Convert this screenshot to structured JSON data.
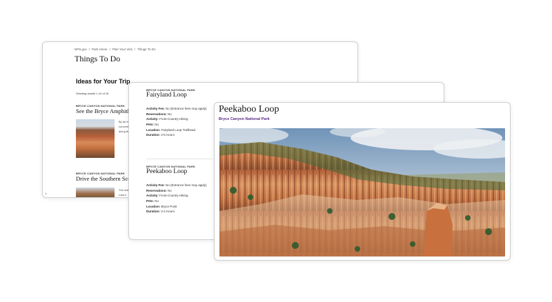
{
  "list_page": {
    "breadcrumb": [
      "NPS.gov",
      "Park Home",
      "Plan Your Visit",
      "Things To Do"
    ],
    "page_title": "Things To Do",
    "section_title": "Ideas for Your Trip",
    "results_count": "Showing results 1-10 of 16",
    "results": [
      {
        "label": "BRYCE CANYON NATIONAL PARK",
        "title": "See the Bryce Amphitheater",
        "excerpt_lines": [
          "By far the",
          "concent",
          "along the"
        ]
      },
      {
        "label": "BRYCE CANYON NATIONAL PARK",
        "title": "Drive the Southern Scenic",
        "excerpt_lines": [
          "The main",
          "road s"
        ]
      }
    ],
    "corner_mark": "↳"
  },
  "detail_list": {
    "items": [
      {
        "label": "BRYCE CANYON NATIONAL PARK",
        "title": "Fairyland Loop",
        "details": [
          {
            "key": "Activity Fee:",
            "value": "No (Entrance fees may apply)"
          },
          {
            "key": "Reservations:",
            "value": "No"
          },
          {
            "key": "Activity:",
            "value": "Front-Country Hiking"
          },
          {
            "key": "Pets:",
            "value": "No"
          },
          {
            "key": "Location:",
            "value": "Fairyland Loop Trailhead"
          },
          {
            "key": "Duration:",
            "value": "4-5 Hours"
          }
        ]
      },
      {
        "label": "BRYCE CANYON NATIONAL PARK",
        "title": "Peekaboo Loop",
        "details": [
          {
            "key": "Activity Fee:",
            "value": "No (Entrance fees may apply)"
          },
          {
            "key": "Reservations:",
            "value": "No"
          },
          {
            "key": "Activity:",
            "value": "Front-Country Hiking"
          },
          {
            "key": "Pets:",
            "value": "No"
          },
          {
            "key": "Location:",
            "value": "Bryce Point"
          },
          {
            "key": "Duration:",
            "value": "3-4 Hours"
          }
        ]
      }
    ]
  },
  "detail_page": {
    "title": "Peekaboo Loop",
    "subtitle": "Bryce Canyon National Park",
    "hero_image": "bryce-canyon-hoodoos-photo"
  },
  "colors": {
    "subtitle_purple": "#5b2a86",
    "card_border": "#cfcfcf"
  }
}
